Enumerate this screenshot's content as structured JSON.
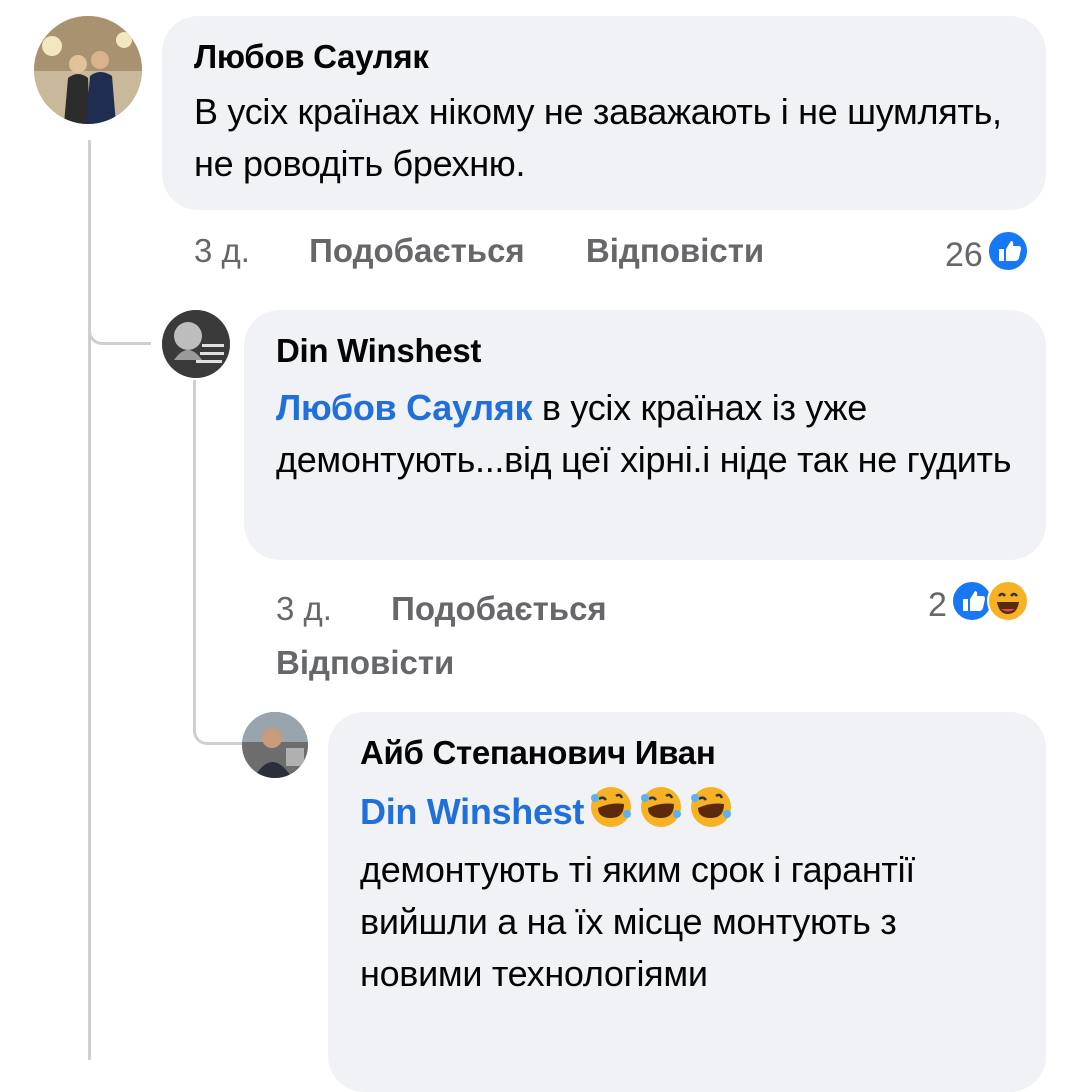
{
  "comments": [
    {
      "author": "Любов Сауляк",
      "text": "В усіх країнах нікому не заважають і не шумлять, не роводіть брехню.",
      "time": "3 д.",
      "like_label": "Подобається",
      "reply_label": "Відповісти",
      "reaction_count": "26",
      "reactions": [
        "like-icon"
      ]
    },
    {
      "author": "Din Winshest",
      "mention": "Любов Сауляк",
      "text": " в усіх країнах із уже демонтують...від цеї хірні.і ніде так не гудить",
      "time": "3 д.",
      "like_label": "Подобається",
      "reply_label": "Відповісти",
      "reaction_count": "2",
      "reactions": [
        "like-icon",
        "laughing-emoji-icon"
      ]
    },
    {
      "author": "Айб Степанович Иван",
      "mention": "Din Winshest",
      "emojis": [
        "rolling-laughing-emoji-icon",
        "rolling-laughing-emoji-icon",
        "rolling-laughing-emoji-icon"
      ],
      "text": "демонтують ті яким срок і гарантії вийшли а на їх місце монтують з новими технологіями"
    }
  ],
  "colors": {
    "bubble": "#f0f2f5",
    "mention": "#216fdb",
    "meta": "#65676b",
    "like": "#1877f2",
    "thread_line": "#ccd0d5"
  }
}
